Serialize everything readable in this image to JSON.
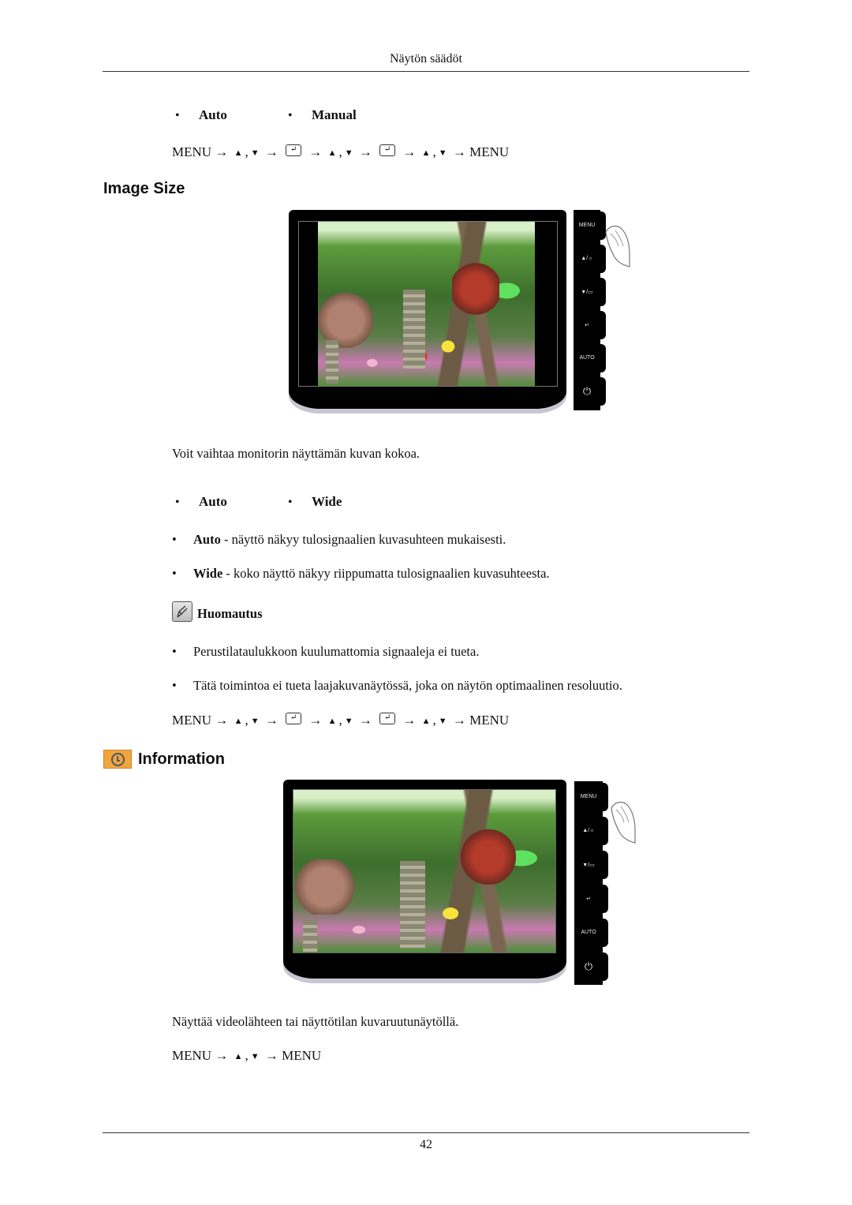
{
  "header": {
    "title": "Näytön säädöt"
  },
  "top_section": {
    "options": [
      "Auto",
      "Manual"
    ],
    "menu_path": [
      "MENU",
      "→",
      "▲",
      ",",
      "▼",
      "→",
      "enter",
      "→",
      "▲",
      ",",
      "▼",
      "→",
      "enter",
      "→",
      "▲",
      ",",
      "▼",
      "→",
      "MENU"
    ]
  },
  "image_size": {
    "title": "Image Size",
    "monitor_buttons": [
      "MENU",
      "▲/☼",
      "▼/▭",
      "↵",
      "AUTO",
      "power"
    ],
    "description": "Voit vaihtaa monitorin näyttämän kuvan kokoa.",
    "options": [
      "Auto",
      "Wide"
    ],
    "details": [
      {
        "term": "Auto",
        "text": " - näyttö näkyy tulosignaalien kuvasuhteen mukaisesti."
      },
      {
        "term": "Wide",
        "text": " - koko näyttö näkyy riippumatta tulosignaalien kuvasuhteesta."
      }
    ],
    "note": {
      "title": "Huomautus",
      "items": [
        "Perustilataulukkoon kuulumattomia signaaleja ei tueta.",
        "Tätä toimintoa ei tueta laajakuvanäytössä, joka on näytön optimaalinen resoluutio."
      ]
    },
    "menu_path": [
      "MENU",
      "→",
      "▲",
      ",",
      "▼",
      "→",
      "enter",
      "→",
      "▲",
      ",",
      "▼",
      "→",
      "enter",
      "→",
      "▲",
      ",",
      "▼",
      "→",
      "MENU"
    ]
  },
  "information": {
    "title": "Information",
    "monitor_buttons": [
      "MENU",
      "▲/☼",
      "▼/▭",
      "↵",
      "AUTO",
      "power"
    ],
    "description": "Näyttää videolähteen tai näyttötilan kuvaruutunäytöllä.",
    "menu_path": [
      "MENU",
      "→",
      "▲",
      ",",
      "▼",
      "→",
      "MENU"
    ]
  },
  "footer": {
    "page_number": "42"
  },
  "colors": {
    "info_icon": "#f3a43c",
    "rule": "#333333"
  }
}
